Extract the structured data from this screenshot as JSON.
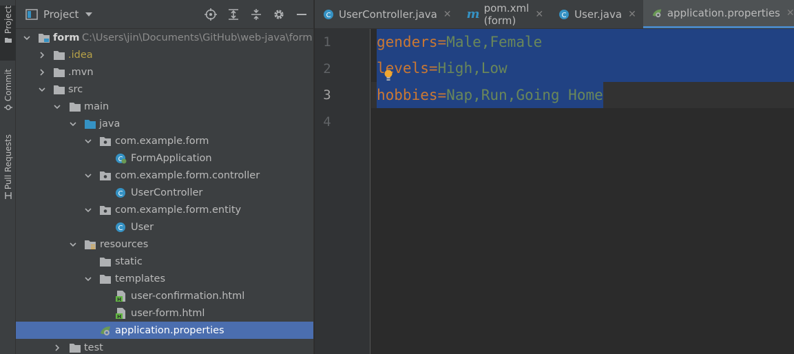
{
  "stripe": {
    "project_label": "Project",
    "commit_label": "Commit",
    "pull_requests_label": "Pull Requests"
  },
  "panel": {
    "title": "Project",
    "tools": [
      "locate-icon",
      "expand-all-icon",
      "collapse-all-icon",
      "gear-icon",
      "hide-icon"
    ]
  },
  "tree": [
    {
      "label": "form",
      "path": "C:\\Users\\jin\\Documents\\GitHub\\web-java\\form",
      "icon": "module-folder-icon",
      "expanded": true
    },
    {
      "label": ".idea",
      "icon": "folder-icon",
      "expanded": false
    },
    {
      "label": ".mvn",
      "icon": "folder-icon",
      "expanded": false
    },
    {
      "label": "src",
      "icon": "folder-icon",
      "expanded": true
    },
    {
      "label": "main",
      "icon": "folder-icon",
      "expanded": true
    },
    {
      "label": "java",
      "icon": "source-folder-icon",
      "expanded": true
    },
    {
      "label": "com.example.form",
      "icon": "package-icon",
      "expanded": true
    },
    {
      "label": "FormApplication",
      "icon": "spring-class-icon"
    },
    {
      "label": "com.example.form.controller",
      "icon": "package-icon",
      "expanded": true
    },
    {
      "label": "UserController",
      "icon": "class-icon"
    },
    {
      "label": "com.example.form.entity",
      "icon": "package-icon",
      "expanded": true
    },
    {
      "label": "User",
      "icon": "class-icon"
    },
    {
      "label": "resources",
      "icon": "resources-folder-icon",
      "expanded": true
    },
    {
      "label": "static",
      "icon": "folder-icon"
    },
    {
      "label": "templates",
      "icon": "folder-icon",
      "expanded": true
    },
    {
      "label": "user-confirmation.html",
      "icon": "html-icon"
    },
    {
      "label": "user-form.html",
      "icon": "html-icon"
    },
    {
      "label": "application.properties",
      "icon": "spring-properties-icon",
      "selected": true
    },
    {
      "label": "test",
      "icon": "folder-icon",
      "expanded": false
    }
  ],
  "tabs": [
    {
      "label": "UserController.java",
      "icon": "class-icon"
    },
    {
      "label": "pom.xml (form)",
      "icon": "maven-icon",
      "icon_text": "m"
    },
    {
      "label": "User.java",
      "icon": "class-icon"
    },
    {
      "label": "application.properties",
      "icon": "spring-properties-icon",
      "active": true
    }
  ],
  "tab_close": "✕",
  "editor": {
    "line_numbers": [
      "1",
      "2",
      "3",
      "4"
    ],
    "current_line": 3,
    "lines": [
      {
        "key": "genders",
        "eq": "=",
        "value": "Male,Female"
      },
      {
        "key": "levels",
        "eq": "=",
        "value": "High,Low"
      },
      {
        "key": "hobbies",
        "eq": "=",
        "value": "Nap,Run,Going Home"
      }
    ]
  },
  "colors": {
    "accent": "#4a88c7",
    "selection": "#214283",
    "tree_selection": "#4b6eaf",
    "key": "#cc7832",
    "value": "#6a8759"
  }
}
